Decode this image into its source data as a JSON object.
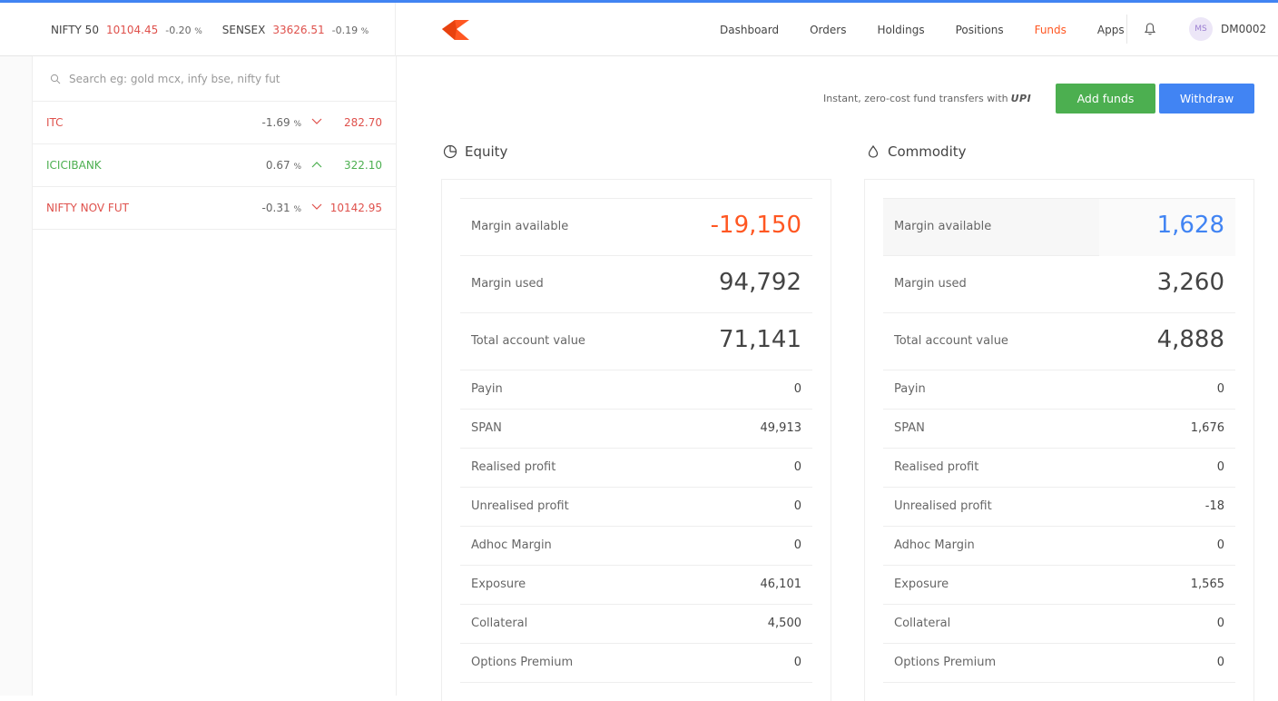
{
  "indices": [
    {
      "name": "NIFTY 50",
      "value": "10104.45",
      "change": "-0.20",
      "unit": "%"
    },
    {
      "name": "SENSEX",
      "value": "33626.51",
      "change": "-0.19",
      "unit": "%"
    }
  ],
  "nav": {
    "items": [
      "Dashboard",
      "Orders",
      "Holdings",
      "Positions",
      "Funds",
      "Apps"
    ],
    "active": "Funds"
  },
  "user": {
    "initials": "MS",
    "id": "DM0002"
  },
  "search": {
    "placeholder": "Search eg: gold mcx, infy bse, nifty fut"
  },
  "watchlist": [
    {
      "name": "ITC",
      "change": "-1.69",
      "unit": "%",
      "price": "282.70",
      "direction": "down"
    },
    {
      "name": "ICICIBANK",
      "change": "0.67",
      "unit": "%",
      "price": "322.10",
      "direction": "up"
    },
    {
      "name": "NIFTY NOV FUT",
      "change": "-0.31",
      "unit": "%",
      "price": "10142.95",
      "direction": "down"
    }
  ],
  "funds": {
    "upi_text": "Instant, zero-cost fund transfers with",
    "upi_logo": "UPI",
    "add_label": "Add funds",
    "withdraw_label": "Withdraw"
  },
  "equity": {
    "title": "Equity",
    "margin_available": {
      "label": "Margin available",
      "value": "-19,150"
    },
    "margin_used": {
      "label": "Margin used",
      "value": "94,792"
    },
    "total_account_value": {
      "label": "Total account value",
      "value": "71,141"
    },
    "details": [
      {
        "label": "Payin",
        "value": "0"
      },
      {
        "label": "SPAN",
        "value": "49,913"
      },
      {
        "label": "Realised profit",
        "value": "0"
      },
      {
        "label": "Unrealised profit",
        "value": "0"
      },
      {
        "label": "Adhoc Margin",
        "value": "0"
      },
      {
        "label": "Exposure",
        "value": "46,101"
      },
      {
        "label": "Collateral",
        "value": "4,500"
      },
      {
        "label": "Options Premium",
        "value": "0"
      }
    ]
  },
  "commodity": {
    "title": "Commodity",
    "margin_available": {
      "label": "Margin available",
      "value": "1,628"
    },
    "margin_used": {
      "label": "Margin used",
      "value": "3,260"
    },
    "total_account_value": {
      "label": "Total account value",
      "value": "4,888"
    },
    "details": [
      {
        "label": "Payin",
        "value": "0"
      },
      {
        "label": "SPAN",
        "value": "1,676"
      },
      {
        "label": "Realised profit",
        "value": "0"
      },
      {
        "label": "Unrealised profit",
        "value": "-18"
      },
      {
        "label": "Adhoc Margin",
        "value": "0"
      },
      {
        "label": "Exposure",
        "value": "1,565"
      },
      {
        "label": "Collateral",
        "value": "0"
      },
      {
        "label": "Options Premium",
        "value": "0"
      }
    ]
  },
  "colors": {
    "accent": "#ff5722",
    "down": "#df514c",
    "up": "#4caf50",
    "blue": "#4184f3",
    "green": "#4caf50"
  }
}
